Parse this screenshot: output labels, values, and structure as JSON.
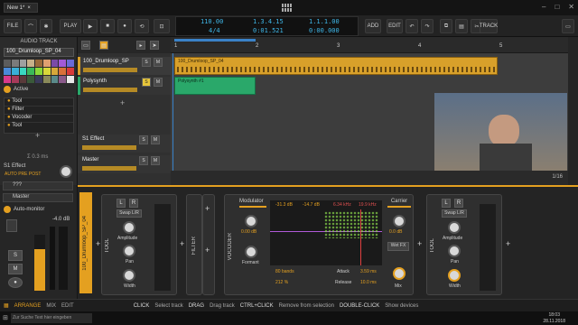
{
  "titlebar": {
    "tab": "New 1*",
    "close": "×"
  },
  "toolbar": {
    "file": "FILE",
    "play": "PLAY",
    "add": "ADD",
    "edit": "EDIT",
    "track": "TRACK",
    "tempo": "110.00",
    "sig": "4/4",
    "pos1": "1.3.4.15",
    "pos2": "0:01.521",
    "pos3": "1.1.1.00",
    "pos4": "0:00.000"
  },
  "left": {
    "header": "AUDIO TRACK",
    "name": "100_Drumloop_SP_04",
    "active": "Active",
    "fx": [
      "Tool",
      "Filter",
      "Vocoder",
      "Tool"
    ],
    "latency": "Σ 0.3 ms",
    "send": "S1 Effect",
    "autoMode": "AUTO PRE POST",
    "route1": "???",
    "route2": "Master",
    "monitor": "Auto-monitor",
    "db": "-4.0 dB"
  },
  "tracks": [
    {
      "name": "100_Drumloop_SP",
      "s": "S",
      "m": "M"
    },
    {
      "name": "Polysynth",
      "s": "S",
      "m": "M"
    },
    {
      "name": "S1 Effect",
      "s": "S",
      "m": "M"
    },
    {
      "name": "Master",
      "s": "S",
      "m": "M"
    }
  ],
  "ruler": {
    "m1": "1",
    "m2": "2",
    "m3": "3",
    "m4": "4",
    "m5": "5"
  },
  "clips": {
    "audio": "100_Drumloop_SP_04",
    "midi": "Polysynth #1"
  },
  "zoom": "1/16",
  "devices": {
    "trackname": "100_Drumloop_SP_04",
    "tool": "TOOL",
    "filter": "FILTER",
    "vocoder": "VOCODER",
    "l": "L",
    "r": "R",
    "swap": "Swap L/R",
    "amp": "Amplitude",
    "pan": "Pan",
    "width": "Width",
    "modulator": "Modulator",
    "gain": "0.00 dB",
    "formant": "Formant",
    "carrier": "Carrier",
    "cgain": "0.0 dB",
    "wetfx": "Wet FX",
    "mix": "Mix",
    "meters": [
      "-31.3 dB",
      "-14.7 dB",
      "6.34 kHz",
      "19.9 kHz"
    ],
    "bands": "80 bands",
    "pct": "212 %",
    "attack": "Attack",
    "attackv": "3.59 ms",
    "release": "Release",
    "releasev": "10.0 ms"
  },
  "bottom": {
    "arrange": "ARRANGE",
    "mix": "MIX",
    "edit": "EDIT",
    "hint1k": "CLICK",
    "hint1": "Select track",
    "hint2k": "DRAG",
    "hint2": "Drag track",
    "hint3k": "CTRL+CLICK",
    "hint3": "Remove from selection",
    "hint4k": "DOUBLE-CLICK",
    "hint4": "Show devices"
  },
  "taskbar": {
    "search": "Zur Suche Text hier eingeben",
    "time": "18:03",
    "date": "28.11.2018"
  },
  "colors": {
    "accent": "#e4a020",
    "audioclip": "#d8a02a",
    "midiclip": "#2aa86a",
    "lcd": "#3fb7e8"
  }
}
